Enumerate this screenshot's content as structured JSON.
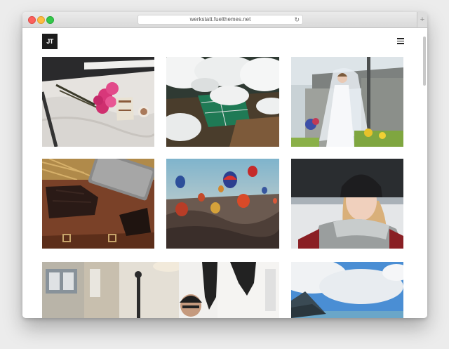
{
  "browser": {
    "url": "werkstatt.fuelthemes.net"
  },
  "site": {
    "logo_text": "JT"
  },
  "icons": {
    "menu": "hamburger-menu-icon",
    "reload": "reload-icon",
    "new_tab": "plus-icon"
  },
  "colors": {
    "close": "#fc615d",
    "minimize": "#fdbc40",
    "maximize": "#34c84a",
    "logo_bg": "#1c1c1c"
  }
}
